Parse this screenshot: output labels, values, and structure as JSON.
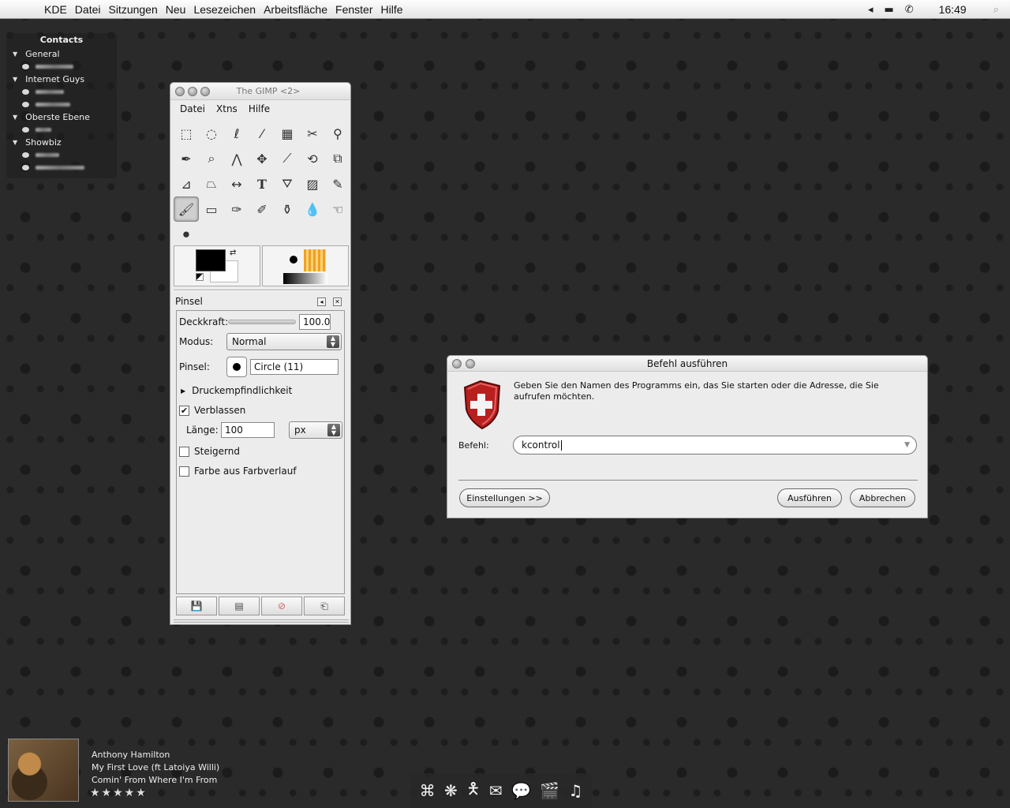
{
  "menubar": {
    "items": [
      "KDE",
      "Datei",
      "Sitzungen",
      "Neu",
      "Lesezeichen",
      "Arbeitsfläche",
      "Fenster",
      "Hilfe"
    ],
    "clock": "16:49"
  },
  "contacts": {
    "title": "Contacts",
    "groups": [
      {
        "name": "General"
      },
      {
        "name": "Internet Guys"
      },
      {
        "name": "Oberste Ebene"
      },
      {
        "name": "Showbiz"
      }
    ]
  },
  "gimp": {
    "title": "The GIMP <2>",
    "menu": [
      "Datei",
      "Xtns",
      "Hilfe"
    ],
    "tool_options": {
      "header": "Pinsel",
      "opacity_label": "Deckkraft:",
      "opacity_value": "100.0",
      "mode_label": "Modus:",
      "mode_value": "Normal",
      "brush_label": "Pinsel:",
      "brush_value": "Circle (11)",
      "pressure_label": "Druckempfindlichkeit",
      "fade_label": "Verblassen",
      "fade_checked": true,
      "length_label": "Länge:",
      "length_value": "100",
      "unit_value": "px",
      "incremental_label": "Steigernd",
      "incremental_checked": false,
      "gradient_label": "Farbe aus Farbverlauf",
      "gradient_checked": false
    }
  },
  "dialog": {
    "title": "Befehl ausführen",
    "description": "Geben Sie den Namen des Programms ein, das Sie starten oder die Adresse, die Sie aufrufen möchten.",
    "command_label": "Befehl:",
    "command_value": "kcontrol",
    "settings_button": "Einstellungen >>",
    "run_button": "Ausführen",
    "cancel_button": "Abbrechen"
  },
  "player": {
    "artist": "Anthony Hamilton",
    "track": "My First Love (ft Latoiya Willi)",
    "album": "Comin' From Where I'm From",
    "rating": 5,
    "rating_stars": "★★★★★"
  },
  "dock": {
    "icons": [
      "command-icon",
      "snowflake-icon",
      "dancer-icon",
      "mailbox-icon",
      "chat-bubble-icon",
      "clapperboard-icon",
      "music-note-icon"
    ]
  }
}
